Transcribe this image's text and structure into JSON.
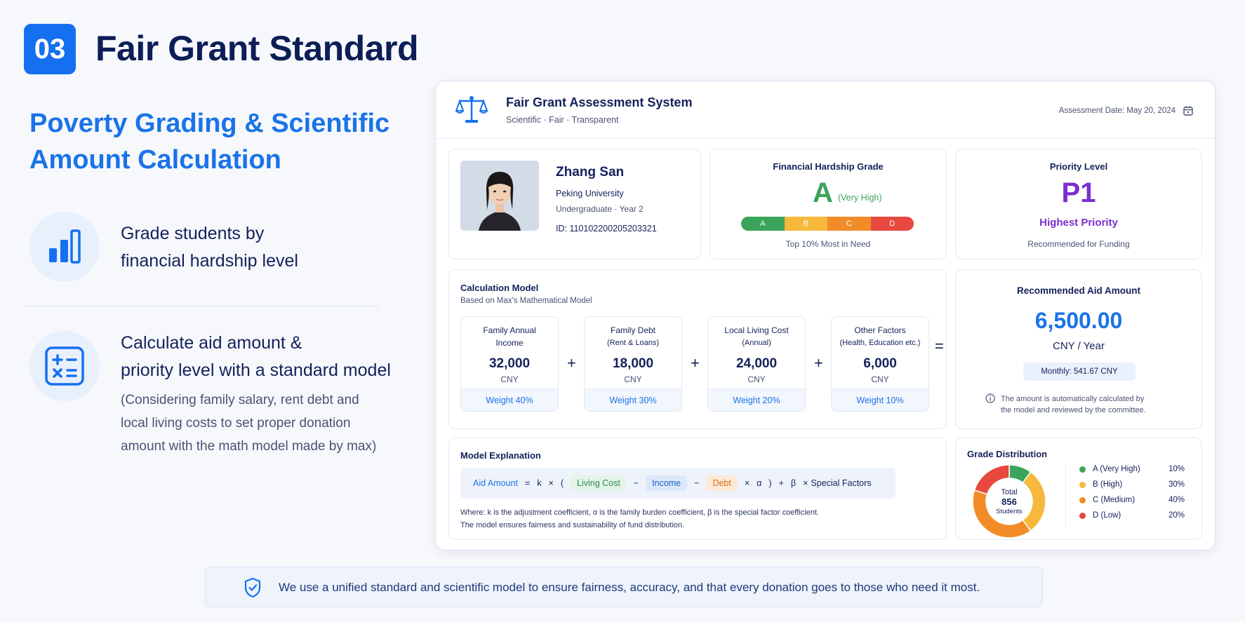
{
  "slide": {
    "number": "03",
    "title": "Fair Grant Standard",
    "subtitle": "Poverty Grading & Scientific Amount Calculation",
    "features": [
      {
        "line1": "Grade students by",
        "line2": "financial hardship level"
      },
      {
        "line1": "Calculate aid amount &",
        "line2": "priority level with a standard model",
        "note1": "(Considering family salary, rent debt and",
        "note2": "local living costs to set proper donation",
        "note3": "amount with the math model made by max)"
      }
    ],
    "footer": "We use a unified standard and scientific model to ensure fairness, accuracy, and that every donation goes to those who need it most."
  },
  "system": {
    "title": "Fair Grant Assessment System",
    "subtitle": "Scientific · Fair · Transparent",
    "assessment_date": "Assessment Date: May 20, 2024"
  },
  "student": {
    "name": "Zhang San",
    "university": "Peking University",
    "program": "Undergraduate · Year 2",
    "id": "ID: 110102200205203321"
  },
  "hardship": {
    "title": "Financial Hardship Grade",
    "grade": "A",
    "grade_desc": "(Very High)",
    "bar_labels": [
      "A",
      "B",
      "C",
      "D"
    ],
    "bar_colors": [
      "#3aa45a",
      "#f6b93b",
      "#f28c28",
      "#e8483d"
    ],
    "note": "Top 10% Most in Need"
  },
  "priority": {
    "title": "Priority Level",
    "level": "P1",
    "label": "Highest Priority",
    "note": "Recommended for Funding"
  },
  "model": {
    "title": "Calculation Model",
    "subtitle": "Based on Max's Mathematical Model",
    "factors": [
      {
        "label1": "Family Annual",
        "label2": "Income",
        "value": "32,000",
        "unit": "CNY",
        "weight": "Weight 40%"
      },
      {
        "label1": "Family Debt",
        "label2": "(Rent & Loans)",
        "value": "18,000",
        "unit": "CNY",
        "weight": "Weight 30%"
      },
      {
        "label1": "Local Living Cost",
        "label2": "(Annual)",
        "value": "24,000",
        "unit": "CNY",
        "weight": "Weight 20%"
      },
      {
        "label1": "Other Factors",
        "label2": "(Health, Education etc.)",
        "value": "6,000",
        "unit": "CNY",
        "weight": "Weight 10%"
      }
    ],
    "plus": "+",
    "equals": "="
  },
  "aid": {
    "title": "Recommended Aid Amount",
    "amount": "6,500.00",
    "unit": "CNY / Year",
    "monthly": "Monthly: 541.67 CNY",
    "note1": "The amount is automatically calculated by",
    "note2": "the model and reviewed by the committee."
  },
  "explanation": {
    "title": "Model Explanation",
    "formula": {
      "aid": "Aid Amount",
      "eq": "=",
      "k": "k",
      "times": "×",
      "lparen": "(",
      "living": "Living Cost",
      "minus": "−",
      "income": "Income",
      "minus2": "−",
      "debt": "Debt",
      "times2": "×",
      "alpha": "α",
      "rparen": ")",
      "plus": "+",
      "beta": "β",
      "times3": "×",
      "special": "Special Factors"
    },
    "line1": "Where: k is the adjustment coefficient, α is the family burden coefficient, β is the special factor coefficient.",
    "line2": "The model ensures fairness and sustainability of fund distribution."
  },
  "distribution": {
    "title": "Grade Distribution",
    "center_label": "Total",
    "center_value": "856",
    "center_unit": "Students",
    "items": [
      {
        "label": "A (Very High)",
        "pct": "10%",
        "value": 10,
        "color": "#3aa45a"
      },
      {
        "label": "B (High)",
        "pct": "30%",
        "value": 30,
        "color": "#f6b93b"
      },
      {
        "label": "C (Medium)",
        "pct": "40%",
        "value": 40,
        "color": "#f28c28"
      },
      {
        "label": "D (Low)",
        "pct": "20%",
        "value": 20,
        "color": "#e8483d"
      }
    ]
  }
}
